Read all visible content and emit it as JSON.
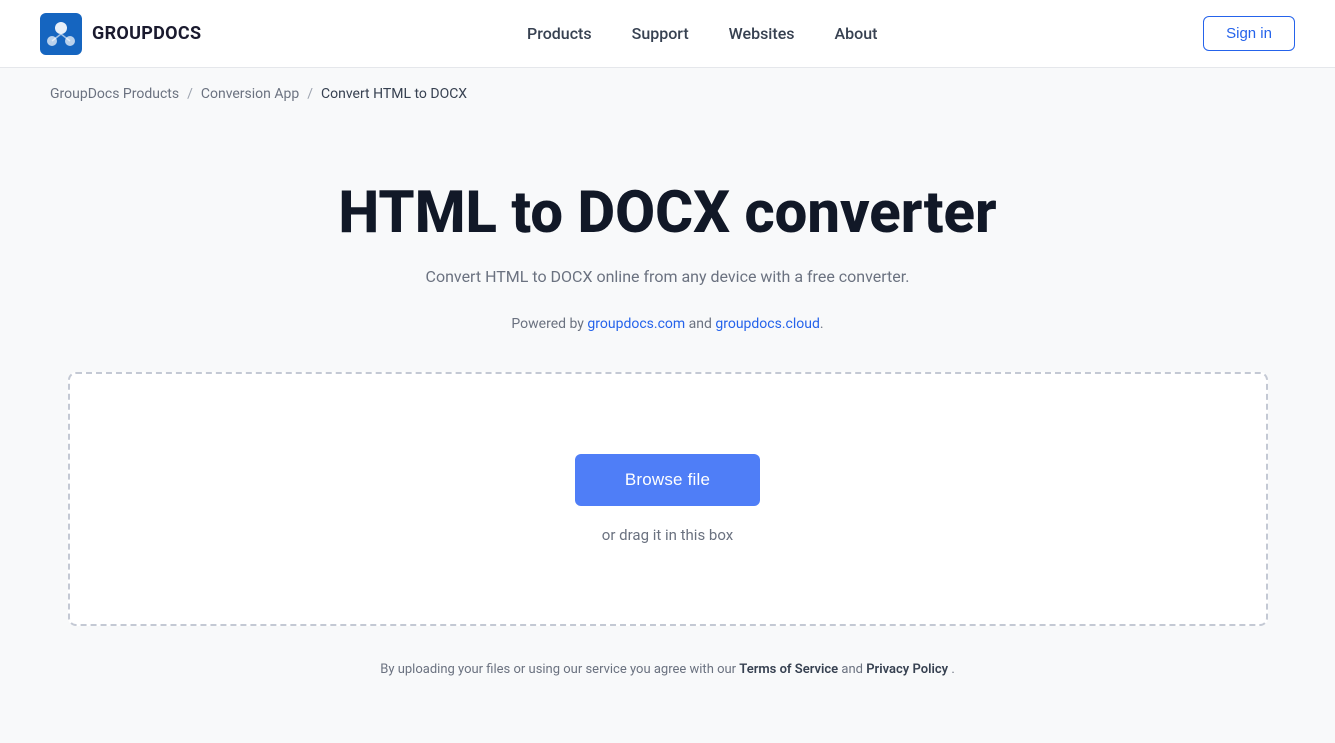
{
  "header": {
    "logo_text": "GROUPDOCS",
    "nav_items": [
      {
        "label": "Products",
        "href": "#"
      },
      {
        "label": "Support",
        "href": "#"
      },
      {
        "label": "Websites",
        "href": "#"
      },
      {
        "label": "About",
        "href": "#"
      }
    ],
    "sign_in_label": "Sign in"
  },
  "breadcrumb": {
    "items": [
      {
        "label": "GroupDocs Products",
        "href": "#"
      },
      {
        "label": "Conversion App",
        "href": "#"
      },
      {
        "label": "Convert HTML to DOCX",
        "href": null
      }
    ]
  },
  "main": {
    "title": "HTML to DOCX converter",
    "subtitle": "Convert HTML to DOCX online from any device with a free converter.",
    "powered_by_prefix": "Powered by",
    "powered_by_link1_label": "groupdocs.com",
    "powered_by_link1_href": "#",
    "powered_by_and": "and",
    "powered_by_link2_label": "groupdocs.cloud",
    "powered_by_link2_href": "#",
    "drop_zone": {
      "browse_button_label": "Browse file",
      "drag_text": "or drag it in this box"
    },
    "footer_note": {
      "prefix": "By uploading your files or using our service you agree with our",
      "tos_label": "Terms of Service",
      "tos_href": "#",
      "and": "and",
      "privacy_label": "Privacy Policy",
      "privacy_href": "#",
      "suffix": "."
    }
  }
}
